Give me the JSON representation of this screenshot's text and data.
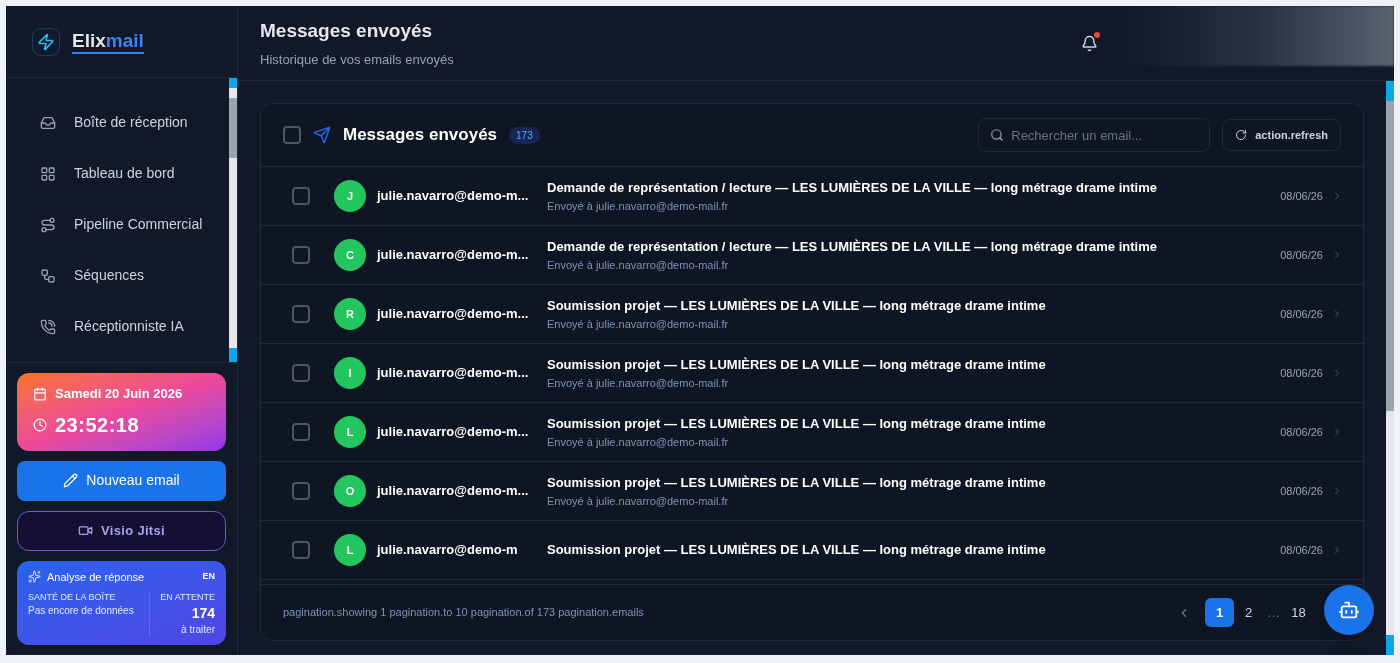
{
  "logo": {
    "text_primary": "Elix",
    "text_accent": "mail"
  },
  "sidebar": {
    "items": [
      {
        "label": "Boîte de réception",
        "selected": false
      },
      {
        "label": "Tableau de bord",
        "selected": false
      },
      {
        "label": "Pipeline Commercial",
        "selected": false
      },
      {
        "label": "Séquences",
        "selected": false
      },
      {
        "label": "Réceptionniste IA",
        "selected": false
      }
    ],
    "date": "Samedi 20 Juin 2026",
    "time": "23:52:18",
    "new_email_button": "Nouveau email",
    "visio_button": "Visio Jitsi",
    "analysis": {
      "title": "Analyse de réponse",
      "lang": "EN",
      "health_label": "SANTÉ DE LA BOÎTE",
      "health_value": "Pas encore de données",
      "pending_label": "EN ATTENTE",
      "pending_count": "174",
      "pending_note": "à traiter"
    }
  },
  "header": {
    "title": "Messages envoyés",
    "subtitle": "Historique de vos emails envoyés",
    "notification": true
  },
  "list": {
    "title": "Messages envoyés",
    "count": "173",
    "select_all_checked": false,
    "search": {
      "placeholder": "Rechercher un email..."
    },
    "refresh_button": "action.refresh",
    "rows": [
      {
        "avatar": "J",
        "sender": "julie.navarro@demo-m...",
        "subject": "Demande de représentation / lecture — LES LUMIÈRES DE LA VILLE — long métrage drame intime",
        "recipient": "Envoyé à julie.navarro@demo-mail.fr",
        "date": "08/06/26",
        "checked": false
      },
      {
        "avatar": "C",
        "sender": "julie.navarro@demo-m...",
        "subject": "Demande de représentation / lecture — LES LUMIÈRES DE LA VILLE — long métrage drame intime",
        "recipient": "Envoyé à julie.navarro@demo-mail.fr",
        "date": "08/06/26",
        "checked": false
      },
      {
        "avatar": "R",
        "sender": "julie.navarro@demo-m...",
        "subject": "Soumission projet — LES LUMIÈRES DE LA VILLE — long métrage drame intime",
        "recipient": "Envoyé à julie.navarro@demo-mail.fr",
        "date": "08/06/26",
        "checked": false
      },
      {
        "avatar": "I",
        "sender": "julie.navarro@demo-m...",
        "subject": "Soumission projet — LES LUMIÈRES DE LA VILLE — long métrage drame intime",
        "recipient": "Envoyé à julie.navarro@demo-mail.fr",
        "date": "08/06/26",
        "checked": false
      },
      {
        "avatar": "L",
        "sender": "julie.navarro@demo-m...",
        "subject": "Soumission projet — LES LUMIÈRES DE LA VILLE — long métrage drame intime",
        "recipient": "Envoyé à julie.navarro@demo-mail.fr",
        "date": "08/06/26",
        "checked": false
      },
      {
        "avatar": "O",
        "sender": "julie.navarro@demo-m...",
        "subject": "Soumission projet — LES LUMIÈRES DE LA VILLE — long métrage drame intime",
        "recipient": "Envoyé à julie.navarro@demo-mail.fr",
        "date": "08/06/26",
        "checked": false
      },
      {
        "avatar": "L",
        "sender": "julie.navarro@demo-m",
        "subject": "Soumission projet — LES LUMIÈRES DE LA VILLE — long métrage drame intime",
        "date": "08/06/26",
        "checked": false
      }
    ],
    "pagination": {
      "summary": "pagination.showing 1 pagination.to 10 pagination.of 173 pagination.emails",
      "pages": [
        {
          "label": "1",
          "selected": true
        },
        {
          "label": "2",
          "selected": false
        },
        {
          "label": "…",
          "kind": "gap"
        },
        {
          "label": "18",
          "selected": false
        }
      ]
    }
  }
}
